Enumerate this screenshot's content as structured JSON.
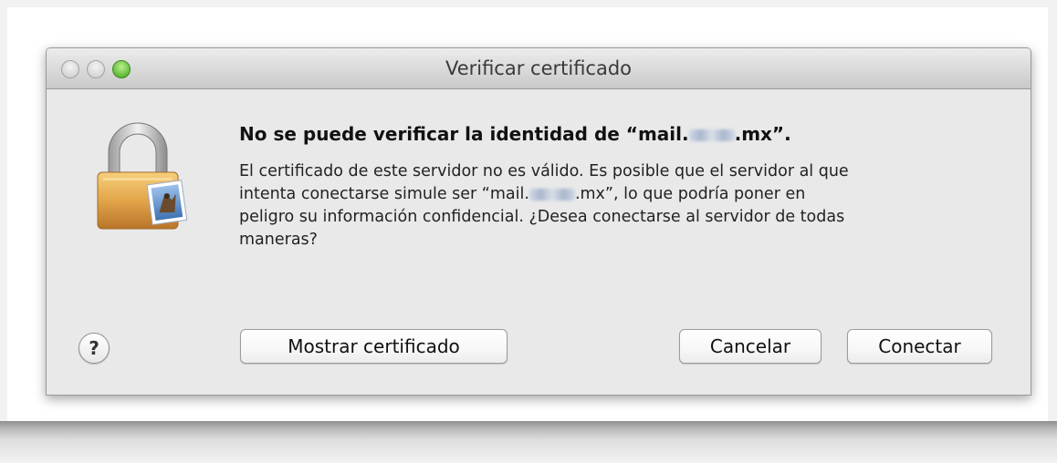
{
  "window": {
    "title": "Verificar certificado"
  },
  "dialog": {
    "heading_prefix": "No se puede verificar la identidad de “mail.",
    "heading_suffix": ".mx”.",
    "body_line1": "El certificado de este servidor no es válido. Es posible que el servidor al que",
    "body_line2_prefix": "intenta conectarse simule ser “mail.",
    "body_line2_suffix": ".mx”, lo que podría poner en",
    "body_line3": "peligro su información confidencial. ¿Desea conectarse al servidor de todas",
    "body_line4": "maneras?",
    "help_label": "?"
  },
  "buttons": {
    "show_certificate": "Mostrar certificado",
    "cancel": "Cancelar",
    "connect": "Conectar"
  },
  "icons": {
    "lock": "lock-with-mail-icon",
    "help": "help-icon"
  }
}
